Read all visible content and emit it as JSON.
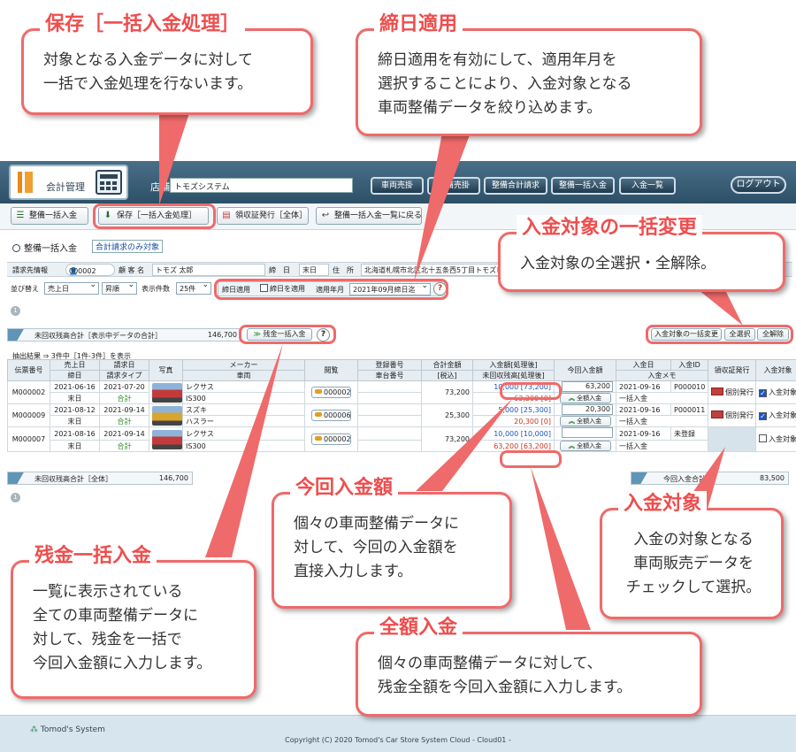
{
  "callouts": {
    "save": {
      "title": "保存［一括入金処理］",
      "body": "対象となる入金データに対して\n一括で入金処理を行ないます。"
    },
    "cutoff": {
      "title": "締日適用",
      "body": "締日適用を有効にして、適用年月を\n選択することにより、入金対象となる\n車両整備データを絞り込めます。"
    },
    "bulk_target": {
      "title": "入金対象の一括変更",
      "body": "入金対象の全選択・全解除。"
    },
    "current_amount": {
      "title": "今回入金額",
      "body": "個々の車両整備データに\n対して、今回の入金額を\n直接入力します。"
    },
    "target": {
      "title": "入金対象",
      "body": "入金の対象となる\n車両販売データを\nチェックして選択。"
    },
    "balance_bulk": {
      "title": "残金一括入金",
      "body": "一覧に表示されている\n全ての車両整備データに\n対して、残金を一括で\n今回入金額に入力します。"
    },
    "full_amount": {
      "title": "全額入金",
      "body": "個々の車両整備データに対して、\n残金全額を今回入金額に入力します。"
    }
  },
  "header": {
    "app_name": "会計管理",
    "store_label": "店舗",
    "store_value": "トモズシステム",
    "nav": [
      "車両売掛",
      "整備売掛",
      "整備合計請求",
      "整備一括入金",
      "入金一覧"
    ],
    "logout": "ログアウト"
  },
  "toolbar": {
    "current": "整備一括入金",
    "save": "保存［一括入金処理］",
    "receipt": "領収証発行［全体］",
    "back": "整備一括入金一覧に戻る"
  },
  "section": {
    "title": "整備一括入金",
    "link": "合計請求のみ対象"
  },
  "billing": {
    "label": "請求先情報",
    "customer_no": "000002",
    "customer_label": "顧 客 名",
    "customer_name": "トモズ 太郎",
    "cutoff_label": "締　日",
    "cutoff_value": "末日",
    "address_label": "住　所",
    "address_value": "北海道札幌市北区北十五条西5丁目トモズビル"
  },
  "controls": {
    "sort_label": "並び替え",
    "sort_value": "売上日",
    "order_value": "昇順",
    "count_label": "表示件数",
    "count_value": "25件",
    "apply_label": "締日適用",
    "apply_check": "締日を適用",
    "month_label": "適用年月",
    "month_value": "2021年09月締日迄"
  },
  "page_number": "1",
  "summary": {
    "unpaid_label": "未回収残高合計［表示中データの合計］",
    "unpaid_value": "146,700",
    "bulk_balance_button": "残金一括入金",
    "bulk_change_label": "入金対象の一括変更",
    "select_all": "全選択",
    "deselect_all": "全解除",
    "results_text": "抽出結果 ⇒ 3件中［1件-3件］を表示"
  },
  "table": {
    "headers_top": [
      "伝票番号",
      "売上日",
      "請求日",
      "写真",
      "メーカー",
      "閲覧",
      "登録番号",
      "合計金額",
      "入金額[処理後]",
      "今回入金額",
      "入金日",
      "入金ID",
      "領収証発行",
      "入金対象",
      "閲覧"
    ],
    "headers_bottom": [
      "",
      "締日",
      "請求タイプ",
      "",
      "車両",
      "",
      "車台番号",
      "[税込]",
      "未回収残高[処理後]",
      "",
      "",
      "入金メモ",
      "",
      "",
      ""
    ],
    "full_button": "全額入金",
    "receipt_button": "個別発行",
    "target_label": "入金対象",
    "rows": [
      {
        "slip": "M000002",
        "sales_date": "2021-06-16",
        "cutoff": "末日",
        "billing_date": "2021-07-20",
        "billing_type": "合計",
        "maker": "レクサス",
        "vehicle": "IS300",
        "view": "000002",
        "total": "73,200",
        "paid": "10,000",
        "paid_after": "[73,200]",
        "remain": "63,200",
        "remain_after": "[0]",
        "current": "63,200",
        "pay_date": "2021-09-16",
        "pay_id": "P000010",
        "memo": "一括入金",
        "target": true
      },
      {
        "slip": "M000009",
        "sales_date": "2021-08-12",
        "cutoff": "末日",
        "billing_date": "2021-09-14",
        "billing_type": "合計",
        "maker": "スズキ",
        "vehicle": "ハスラー",
        "view": "000006",
        "total": "25,300",
        "paid": "5,000",
        "paid_after": "[25,300]",
        "remain": "20,300",
        "remain_after": "[0]",
        "current": "20,300",
        "pay_date": "2021-09-16",
        "pay_id": "P000011",
        "memo": "一括入金",
        "target": true
      },
      {
        "slip": "M000007",
        "sales_date": "2021-08-16",
        "cutoff": "末日",
        "billing_date": "2021-09-14",
        "billing_type": "合計",
        "maker": "レクサス",
        "vehicle": "IS300",
        "view": "000002",
        "total": "73,200",
        "paid": "10,000",
        "paid_after": "[10,000]",
        "remain": "63,200",
        "remain_after": "[63,200]",
        "current": "",
        "pay_date": "2021-09-16",
        "pay_id": "未登録",
        "memo": "一括入金",
        "target": false
      }
    ]
  },
  "totals": {
    "unpaid_all_label": "未回収残高合計［全体］",
    "unpaid_all_value": "146,700",
    "current_total_label": "今回入金合計",
    "current_total_value": "83,500"
  },
  "footer": {
    "logo": "Tomod's System",
    "copyright": "Copyright (C) 2020 Tomod's Car Store System Cloud - Cloud01 -"
  },
  "colors": {
    "accent": "#ef6a6a",
    "header": "#2d5068"
  }
}
